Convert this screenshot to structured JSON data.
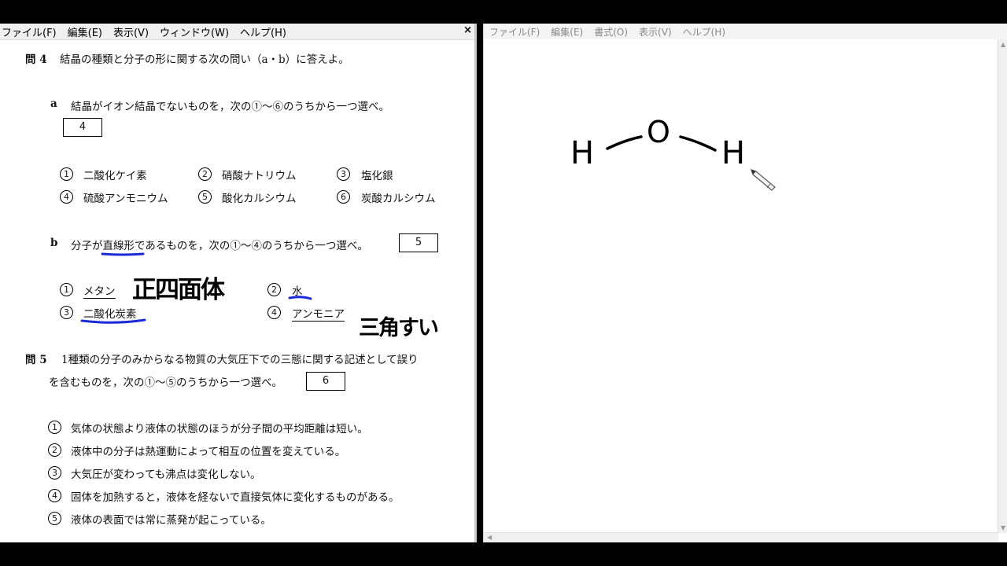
{
  "left_window": {
    "menu": [
      "ファイル(F)",
      "編集(E)",
      "表示(V)",
      "ウィンドウ(W)",
      "ヘルプ(H)"
    ],
    "close": "×",
    "q4": {
      "label": "問 4",
      "text": "結晶の種類と分子の形に関する次の問い（a・b）に答えよ。",
      "a": {
        "label": "a",
        "text": "結晶がイオン結晶でないものを，次の①～⑥のうちから一つ選べ。",
        "answer_box": "4",
        "options": [
          {
            "num": "1",
            "text": "二酸化ケイ素"
          },
          {
            "num": "2",
            "text": "硝酸ナトリウム"
          },
          {
            "num": "3",
            "text": "塩化銀"
          },
          {
            "num": "4",
            "text": "硫酸アンモニウム"
          },
          {
            "num": "5",
            "text": "酸化カルシウム"
          },
          {
            "num": "6",
            "text": "炭酸カルシウム"
          }
        ]
      },
      "b": {
        "label": "b",
        "text": "分子が直線形であるものを，次の①～④のうちから一つ選べ。",
        "answer_box": "5",
        "options": [
          {
            "num": "1",
            "text": "メタン"
          },
          {
            "num": "2",
            "text": "水"
          },
          {
            "num": "3",
            "text": "二酸化炭素"
          },
          {
            "num": "4",
            "text": "アンモニア"
          }
        ],
        "handwritten": [
          "正四面体",
          "三角すい"
        ]
      }
    },
    "q5": {
      "label": "問 5",
      "text_line1": "1種類の分子のみからなる物質の大気圧下での三態に関する記述として誤り",
      "text_line2": "を含むものを，次の①～⑤のうちから一つ選べ。",
      "answer_box": "6",
      "options": [
        {
          "num": "1",
          "text": "気体の状態より液体の状態のほうが分子間の平均距離は短い。"
        },
        {
          "num": "2",
          "text": "液体中の分子は熱運動によって相互の位置を変えている。"
        },
        {
          "num": "3",
          "text": "大気圧が変わっても沸点は変化しない。"
        },
        {
          "num": "4",
          "text": "固体を加熱すると，液体を経ないで直接気体に変化するものがある。"
        },
        {
          "num": "5",
          "text": "液体の表面では常に蒸発が起こっている。"
        }
      ]
    }
  },
  "right_window": {
    "menu": [
      "ファイル(F)",
      "編集(E)",
      "書式(O)",
      "表示(V)",
      "ヘルプ(H)"
    ],
    "drawing": {
      "atoms": [
        "H",
        "O",
        "H"
      ],
      "tool_icon": "pencil-icon"
    }
  },
  "colors": {
    "ink_blue": "#1a2ad6",
    "ink_black": "#000000"
  }
}
